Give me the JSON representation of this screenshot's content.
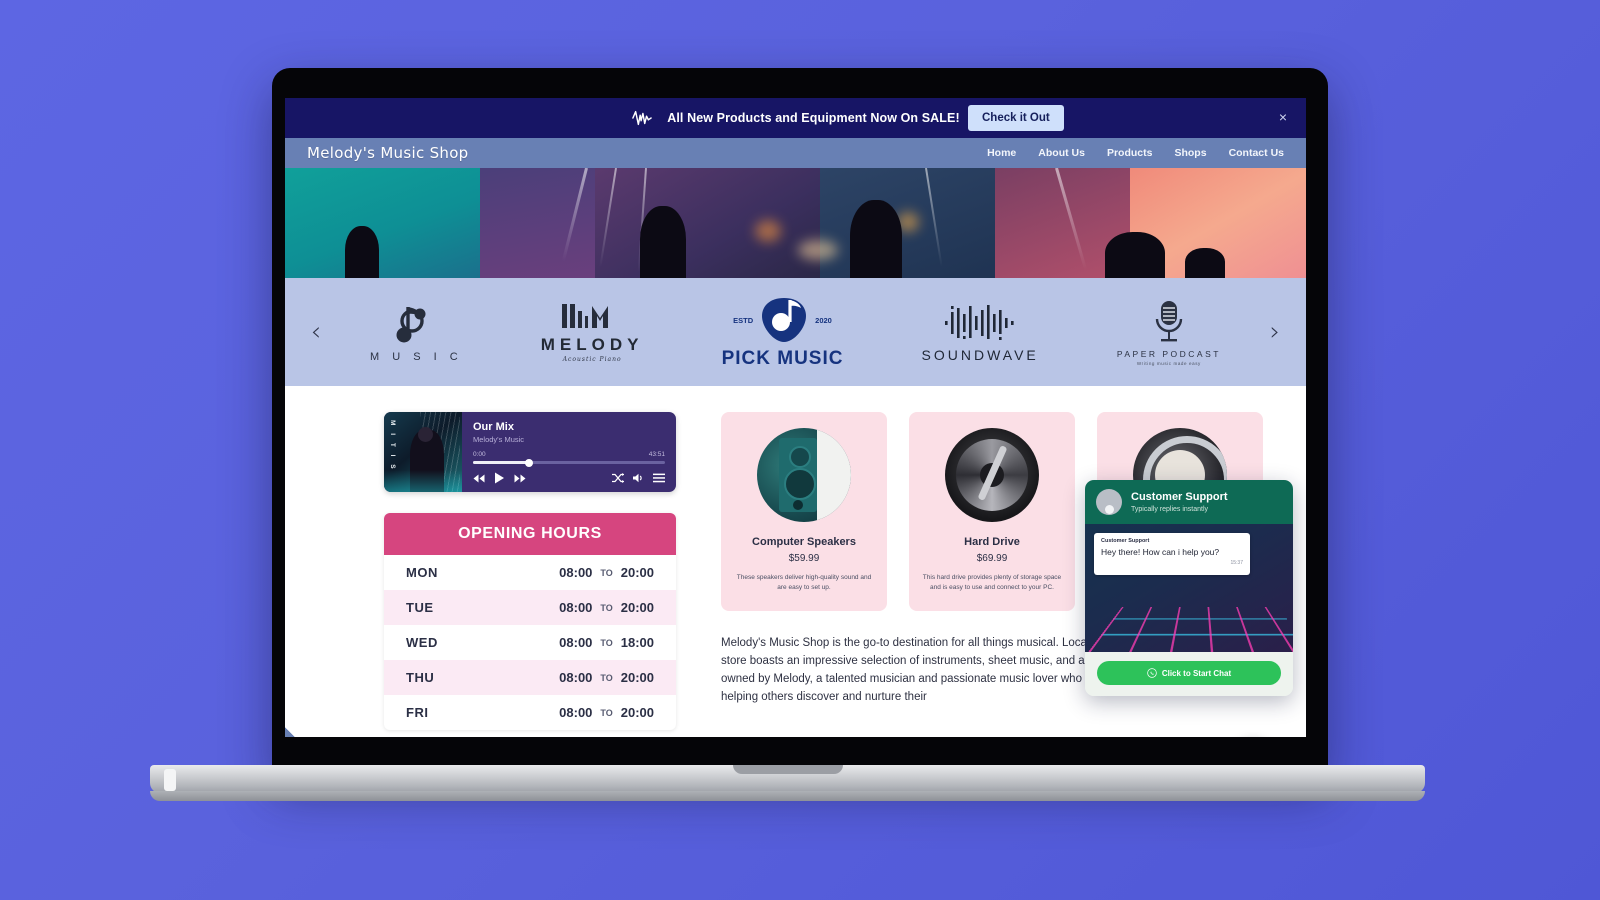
{
  "announcement": {
    "icon": "soundwave-icon",
    "text": "All New Products and Equipment Now On SALE!",
    "button_label": "Check it Out",
    "close_label": "×",
    "bg_color": "#171565"
  },
  "nav": {
    "brand": "Melody's Music Shop",
    "bg_color": "#6880b4",
    "links": [
      {
        "label": "Home"
      },
      {
        "label": "About Us"
      },
      {
        "label": "Products"
      },
      {
        "label": "Shops"
      },
      {
        "label": "Contact Us"
      }
    ]
  },
  "carousel": {
    "prev_label": "‹",
    "next_label": "›",
    "bg_color": "#b9c5e6",
    "logos": [
      {
        "name": "music",
        "caption": "M U S I C"
      },
      {
        "name": "melody",
        "caption": "MELODY",
        "subcaption": "Acoustic Piano"
      },
      {
        "name": "pick-music",
        "caption": "PICK MUSIC",
        "estd": "ESTD",
        "year": "2020"
      },
      {
        "name": "soundwave",
        "caption": "SOUNDWAVE"
      },
      {
        "name": "paper-podcast",
        "caption": "PAPER PODCAST",
        "subcaption": "Writing music made easy"
      }
    ]
  },
  "player": {
    "track_title": "Our Mix",
    "artist": "Melody's Music",
    "current_time": "0:00",
    "duration": "43:51",
    "album_text": "M I T I S",
    "progress_percent": 28,
    "controls": [
      "rewind-icon",
      "play-icon",
      "forward-icon"
    ],
    "right_controls": [
      "shuffle-icon",
      "volume-icon",
      "playlist-icon"
    ]
  },
  "hours": {
    "title": "OPENING HOURS",
    "header_color": "#d6457f",
    "separator": "TO",
    "rows": [
      {
        "day": "MON",
        "open": "08:00",
        "close": "20:00"
      },
      {
        "day": "TUE",
        "open": "08:00",
        "close": "20:00"
      },
      {
        "day": "WED",
        "open": "08:00",
        "close": "18:00"
      },
      {
        "day": "THU",
        "open": "08:00",
        "close": "20:00"
      },
      {
        "day": "FRI",
        "open": "08:00",
        "close": "20:00"
      }
    ]
  },
  "products": [
    {
      "image": "computer-speakers-photo",
      "name": "Computer Speakers",
      "price": "$59.99",
      "description": "These speakers deliver high-quality sound and are easy to set up."
    },
    {
      "image": "hard-drive-photo",
      "name": "Hard Drive",
      "price": "$69.99",
      "description": "This hard drive provides plenty of storage space and is easy to use and connect to your PC."
    },
    {
      "image": "drum-photo",
      "name": "",
      "price": "",
      "description": ""
    }
  ],
  "about": {
    "paragraph": "Melody's Music Shop is the go-to destination for all things musical. Located in the heart of downtown, the store boasts an impressive selection of instruments, sheet music, and audio equipment. The store is owned by Melody, a talented musician and passionate music lover who has dedicated her career to helping others discover and nurture their"
  },
  "chat": {
    "title": "Customer Support",
    "subtitle": "Typically replies instantly",
    "avatar": "person-avatar-icon",
    "message_sender": "Customer Support",
    "message_text": "Hey there! How can i help you?",
    "message_time": "15:37",
    "button_label": "Click to Start Chat",
    "button_icon": "whatsapp-icon",
    "header_color": "#0e6a55",
    "button_color": "#2dc25a"
  },
  "floating": {
    "whatsapp_icon": "whatsapp-icon",
    "whatsapp_color": "#35c75a",
    "settings_icon": "gear-icon"
  }
}
